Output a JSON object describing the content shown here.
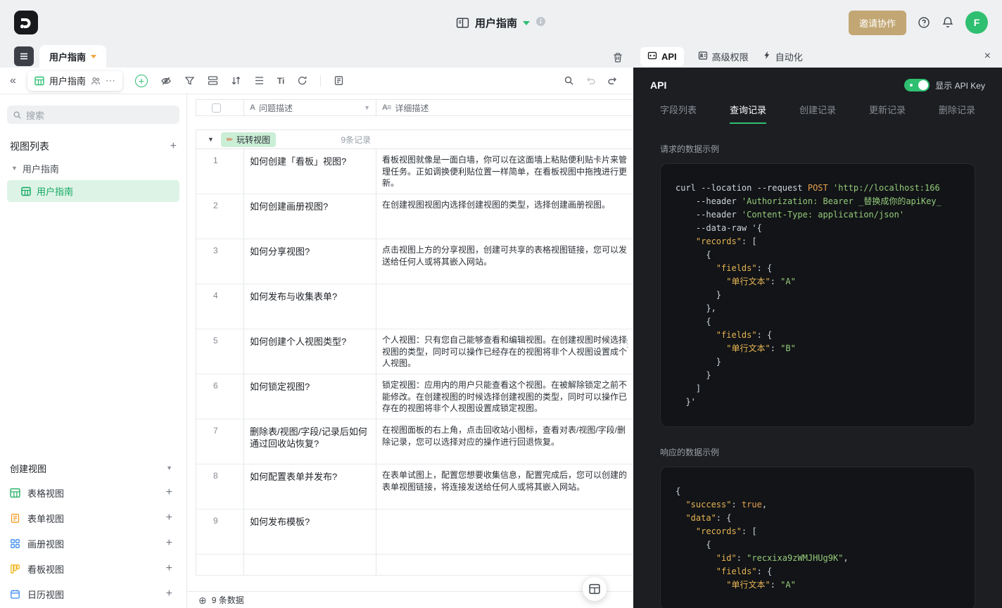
{
  "colors": {
    "accent_green": "#2fbf71",
    "invite_tan": "#c2a673",
    "panel_dark": "#1c1e21",
    "code_bg": "#121417",
    "badge_green": "#cbeed6",
    "selected_green_bg": "#ddf3e6"
  },
  "header": {
    "doc_title": "用户指南",
    "invite_label": "邀请协作",
    "avatar_initial": "F"
  },
  "tabbar": {
    "doc_tab": "用户指南",
    "api_tab": "API",
    "perm_tab": "高级权限",
    "auto_tab": "自动化"
  },
  "toolbar": {
    "view_tab_label": "用户指南",
    "ti_icon_label": "Ti"
  },
  "sidebar": {
    "search_placeholder": "搜索",
    "view_list_title": "视图列表",
    "tree_parent": "用户指南",
    "tree_child": "用户指南",
    "create_view_title": "创建视图",
    "view_types": [
      {
        "label": "表格视图",
        "color": "#2fb46c",
        "type": "grid"
      },
      {
        "label": "表单视图",
        "color": "#f59a23",
        "type": "form"
      },
      {
        "label": "画册视图",
        "color": "#3a8af0",
        "type": "gallery"
      },
      {
        "label": "看板视图",
        "color": "#f0b418",
        "type": "kanban"
      },
      {
        "label": "日历视图",
        "color": "#3a8af0",
        "type": "calendar"
      }
    ]
  },
  "table": {
    "col_question": "问题描述",
    "col_detail": "详细描述",
    "group_badge": "玩转视图",
    "group_count": "9条记录",
    "footer_count": "9 条数据",
    "rows": [
      {
        "num": "1",
        "question": "如何创建「看板」视图?",
        "detail": "看板视图就像是一面白墙，你可以在这面墙上粘贴便利贴卡片来管理任务。正如调换便利贴位置一样简单，在看板视图中拖拽进行更新。"
      },
      {
        "num": "2",
        "question": "如何创建画册视图?",
        "detail": "在创建视图视图内选择创建视图的类型，选择创建画册视图。"
      },
      {
        "num": "3",
        "question": "如何分享视图?",
        "detail": "点击视图上方的分享视图，创建可共享的表格视图链接，您可以发送给任何人或将其嵌入网站。"
      },
      {
        "num": "4",
        "question": "如何发布与收集表单?",
        "detail": ""
      },
      {
        "num": "5",
        "question": "如何创建个人视图类型?",
        "detail": "个人视图：只有您自己能够查看和编辑视图。在创建视图时候选择视图的类型，同时可以操作已经存在的视图将非个人视图设置成个人视图。"
      },
      {
        "num": "6",
        "question": "如何锁定视图?",
        "detail": "锁定视图：应用内的用户只能查看这个视图。在被解除锁定之前不能修改。在创建视图的时候选择创建视图的类型，同时可以操作已存在的视图将非个人视图设置成锁定视图。"
      },
      {
        "num": "7",
        "question": "删除表/视图/字段/记录后如何通过回收站恢复?",
        "detail": "在视图面板的右上角，点击回收站小图标，查看对表/视图/字段/删除记录，您可以选择对应的操作进行回退恢复。"
      },
      {
        "num": "8",
        "question": "如何配置表单并发布?",
        "detail": "在表单试图上，配置您想要收集信息，配置完成后，您可以创建的表单视图链接，将连接发送给任何人或将其嵌入网站。"
      },
      {
        "num": "9",
        "question": "如何发布模板?",
        "detail": ""
      }
    ]
  },
  "api_panel": {
    "title": "API",
    "toggle_label": "显示 API Key",
    "tabs": [
      "字段列表",
      "查询记录",
      "创建记录",
      "更新记录",
      "删除记录"
    ],
    "active_tab": "查询记录",
    "request_label": "请求的数据示例",
    "response_label": "响应的数据示例",
    "request_code": [
      [
        [
          "p",
          "curl --location --request "
        ],
        [
          "w",
          "POST"
        ],
        [
          "p",
          " "
        ],
        [
          "s",
          "'http://localhost:166"
        ]
      ],
      [
        [
          "p",
          "    --header "
        ],
        [
          "s",
          "'Authorization: Bearer _替换成你的apiKey_"
        ]
      ],
      [
        [
          "p",
          "    --header "
        ],
        [
          "s",
          "'Content-Type: application/json'"
        ]
      ],
      [
        [
          "p",
          "    --data-raw '{"
        ]
      ],
      [
        [
          "k",
          "    \"records\""
        ],
        [
          "p",
          ": ["
        ]
      ],
      [
        [
          "p",
          "      {"
        ]
      ],
      [
        [
          "k",
          "        \"fields\""
        ],
        [
          "p",
          ": {"
        ]
      ],
      [
        [
          "k",
          "          \"单行文本\""
        ],
        [
          "p",
          ": "
        ],
        [
          "s",
          "\"A\""
        ]
      ],
      [
        [
          "p",
          "        }"
        ]
      ],
      [
        [
          "p",
          "      },"
        ]
      ],
      [
        [
          "p",
          "      {"
        ]
      ],
      [
        [
          "k",
          "        \"fields\""
        ],
        [
          "p",
          ": {"
        ]
      ],
      [
        [
          "k",
          "          \"单行文本\""
        ],
        [
          "p",
          ": "
        ],
        [
          "s",
          "\"B\""
        ]
      ],
      [
        [
          "p",
          "        }"
        ]
      ],
      [
        [
          "p",
          "      }"
        ]
      ],
      [
        [
          "p",
          "    ]"
        ]
      ],
      [
        [
          "p",
          "  }'"
        ]
      ]
    ],
    "response_code": [
      [
        [
          "p",
          "{"
        ]
      ],
      [
        [
          "k",
          "  \"success\""
        ],
        [
          "p",
          ": "
        ],
        [
          "w",
          "true"
        ],
        [
          "p",
          ","
        ]
      ],
      [
        [
          "k",
          "  \"data\""
        ],
        [
          "p",
          ": {"
        ]
      ],
      [
        [
          "k",
          "    \"records\""
        ],
        [
          "p",
          ": ["
        ]
      ],
      [
        [
          "p",
          "      {"
        ]
      ],
      [
        [
          "k",
          "        \"id\""
        ],
        [
          "p",
          ": "
        ],
        [
          "s",
          "\"recxixa9zWMJHUg9K\""
        ],
        [
          "p",
          ","
        ]
      ],
      [
        [
          "k",
          "        \"fields\""
        ],
        [
          "p",
          ": {"
        ]
      ],
      [
        [
          "k",
          "          \"单行文本\""
        ],
        [
          "p",
          ": "
        ],
        [
          "s",
          "\"A\""
        ]
      ]
    ]
  }
}
